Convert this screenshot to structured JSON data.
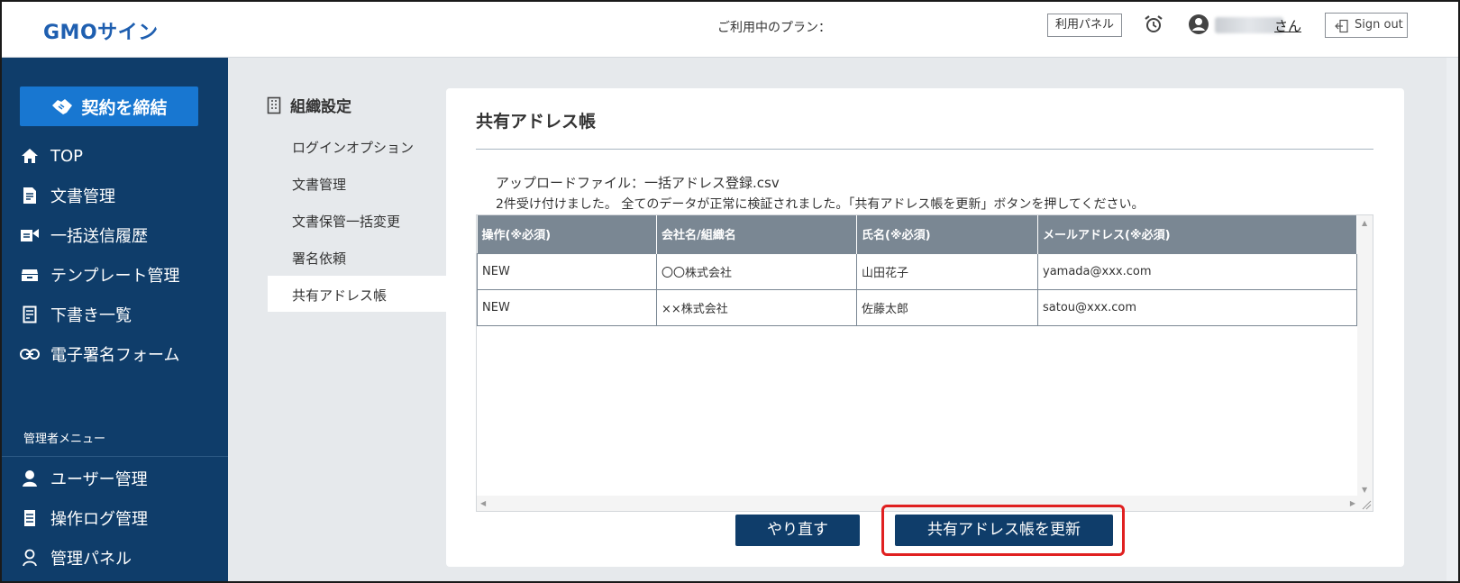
{
  "header": {
    "logo": "GMOサイン",
    "plan_label": "ご利用中のプラン：",
    "panel_button": "利用パネル",
    "user_suffix": "さん",
    "signout_label": "Sign out"
  },
  "sidebar": {
    "cta_label": "契約を締結",
    "items": [
      {
        "label": "TOP",
        "icon": "home-icon"
      },
      {
        "label": "文書管理",
        "icon": "document-icon"
      },
      {
        "label": "一括送信履歴",
        "icon": "bulk-send-icon"
      },
      {
        "label": "テンプレート管理",
        "icon": "template-icon"
      },
      {
        "label": "下書き一覧",
        "icon": "draft-icon"
      },
      {
        "label": "電子署名フォーム",
        "icon": "link-icon"
      }
    ],
    "admin_menu_label": "管理者メニュー",
    "admin_items": [
      {
        "label": "ユーザー管理",
        "icon": "user-icon"
      },
      {
        "label": "操作ログ管理",
        "icon": "log-icon"
      },
      {
        "label": "管理パネル",
        "icon": "admin-panel-icon"
      }
    ]
  },
  "submenu": {
    "title": "組織設定",
    "items": [
      "ログインオプション",
      "文書管理",
      "文書保管一括変更",
      "署名依頼",
      "共有アドレス帳"
    ],
    "active_index": 4
  },
  "main": {
    "title": "共有アドレス帳",
    "upload_file_line": "アップロードファイル：一括アドレス登録.csv",
    "status_message": "2件受け付けました。 全てのデータが正常に検証されました。「共有アドレス帳を更新」ボタンを押してください。",
    "table": {
      "columns": [
        "操作(※必須)",
        "会社名/組織名",
        "氏名(※必須)",
        "メールアドレス(※必須)"
      ],
      "rows": [
        [
          "NEW",
          "〇〇株式会社",
          "山田花子",
          "yamada@xxx.com"
        ],
        [
          "NEW",
          "××株式会社",
          "佐藤太郎",
          "satou@xxx.com"
        ]
      ]
    },
    "redo_button": "やり直す",
    "update_button": "共有アドレス帳を更新"
  },
  "colors": {
    "sidebar_bg": "#0f3d6a",
    "cta_bg": "#1877d1",
    "table_header_bg": "#7a8793",
    "highlight": "#e02020"
  }
}
